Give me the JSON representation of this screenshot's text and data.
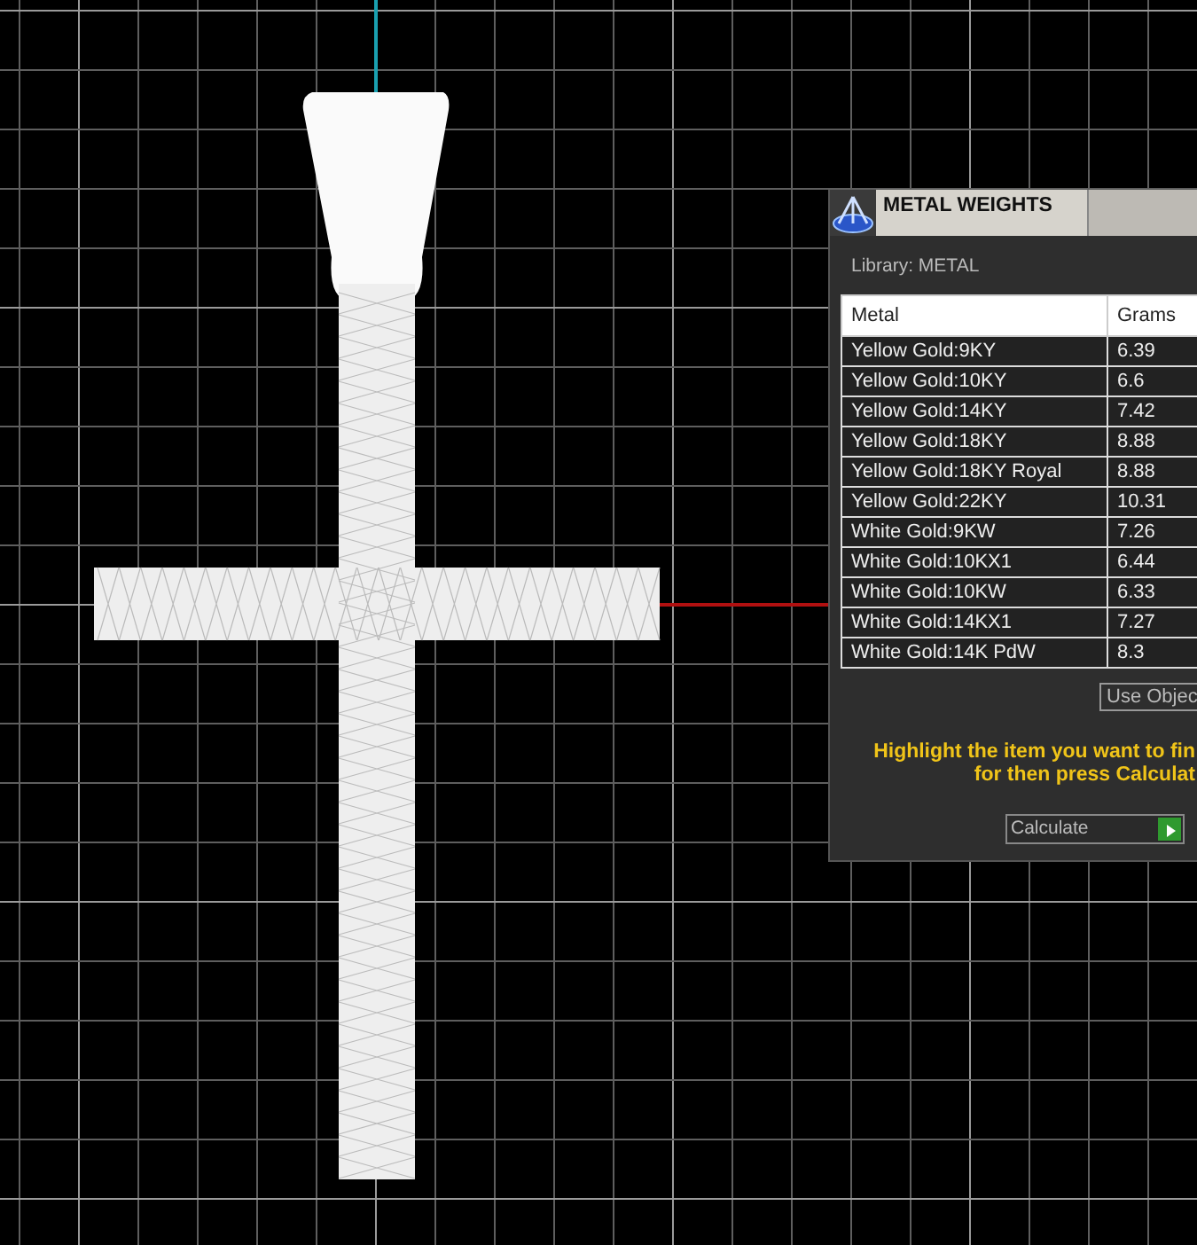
{
  "panel": {
    "title": "METAL WEIGHTS",
    "library": "Library: METAL",
    "table": {
      "columns": [
        "Metal",
        "Grams"
      ],
      "rows": [
        [
          "Yellow Gold:9KY",
          "6.39"
        ],
        [
          "Yellow Gold:10KY",
          "6.6"
        ],
        [
          "Yellow Gold:14KY",
          "7.42"
        ],
        [
          "Yellow Gold:18KY",
          "8.88"
        ],
        [
          "Yellow Gold:18KY Royal",
          "8.88"
        ],
        [
          "Yellow Gold:22KY",
          "10.31"
        ],
        [
          "White Gold:9KW",
          "7.26"
        ],
        [
          "White Gold:10KX1",
          "6.44"
        ],
        [
          "White Gold:10KW",
          "6.33"
        ],
        [
          "White Gold:14KX1",
          "7.27"
        ],
        [
          "White Gold:14K PdW",
          "8.3"
        ]
      ]
    },
    "use_object_button": "Use Objec",
    "instruction": [
      "Highlight the item you want to fin",
      "for then press Calculat"
    ],
    "calculate_select": "Calculate"
  }
}
